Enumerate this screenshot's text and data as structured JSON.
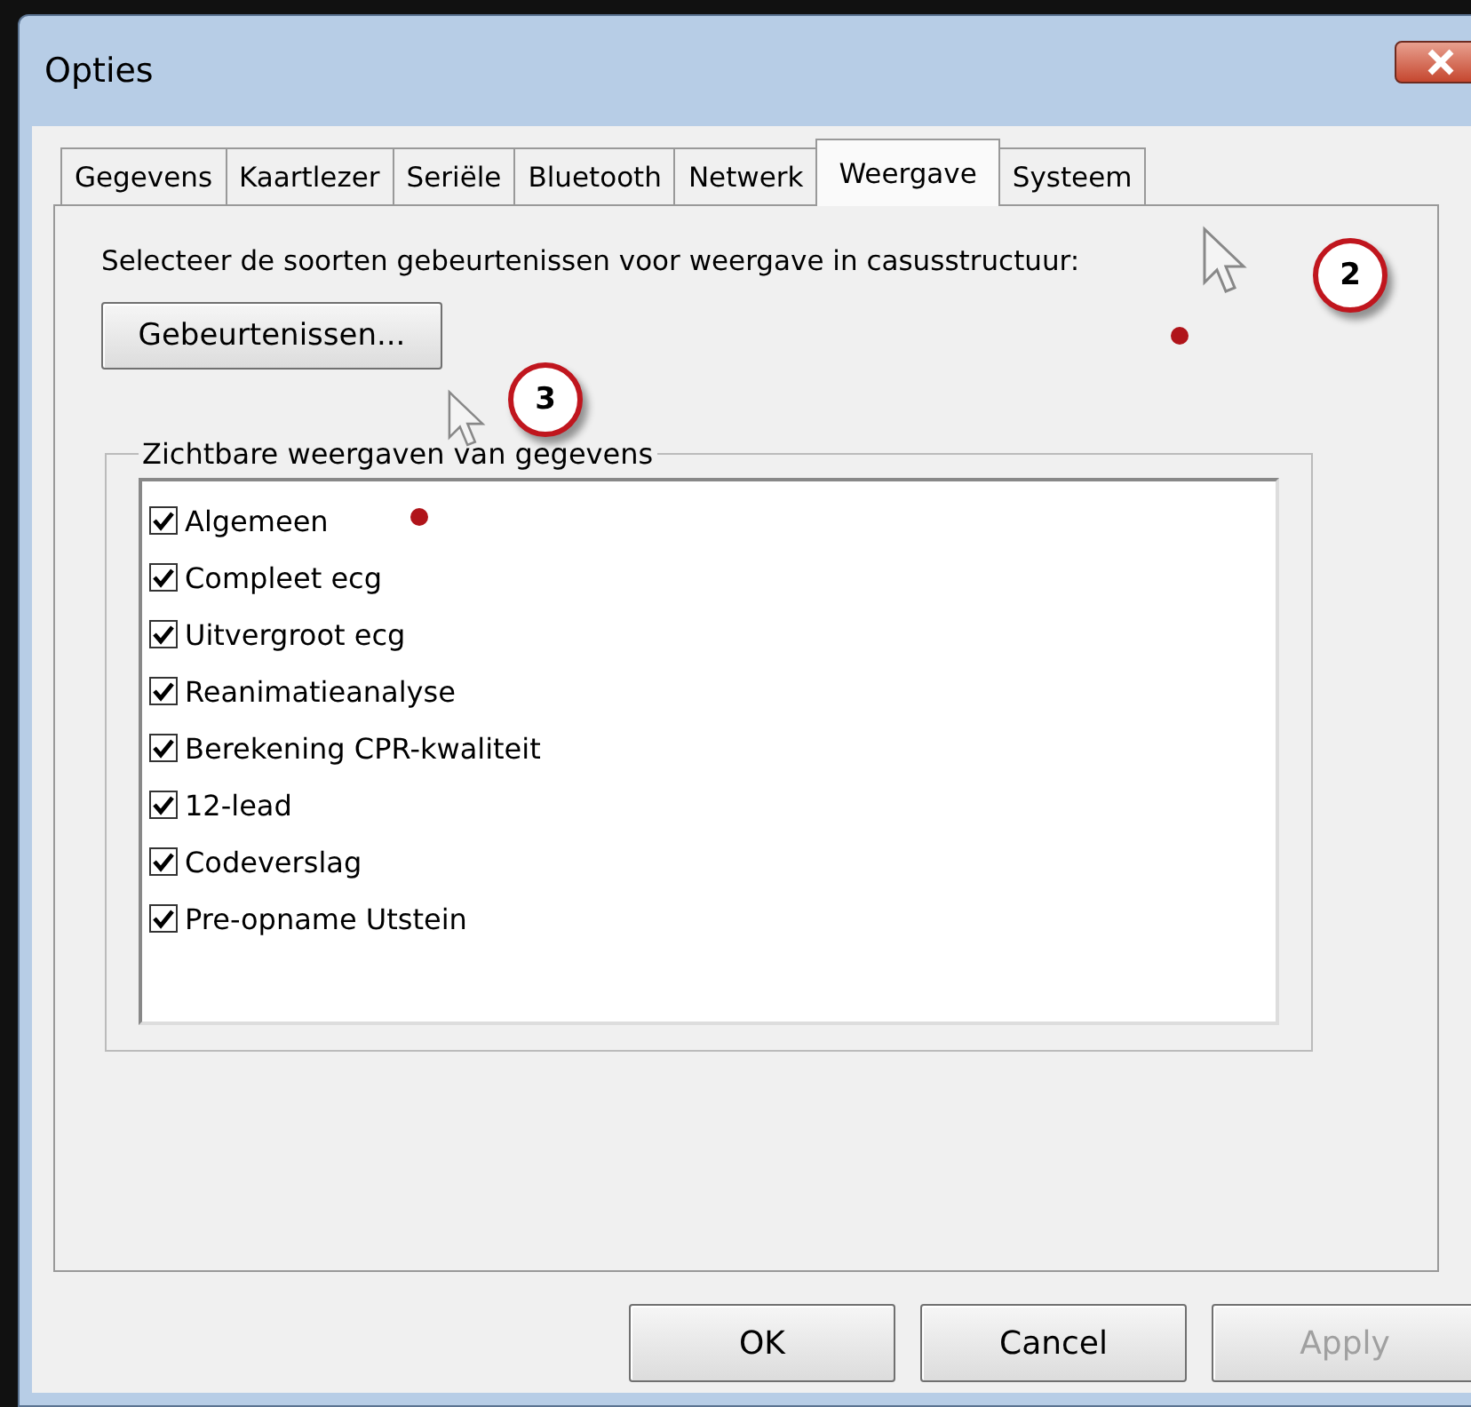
{
  "window": {
    "title": "Opties"
  },
  "tabs": [
    {
      "label": "Gegevens",
      "selected": false
    },
    {
      "label": "Kaartlezer",
      "selected": false
    },
    {
      "label": "Seriële",
      "selected": false
    },
    {
      "label": "Bluetooth",
      "selected": false
    },
    {
      "label": "Netwerk",
      "selected": false
    },
    {
      "label": "Weergave",
      "selected": true
    },
    {
      "label": "Systeem",
      "selected": false
    }
  ],
  "instruction": "Selecteer de soorten gebeurtenissen voor weergave in casusstructuur:",
  "events_button": {
    "label": "Gebeurtenissen..."
  },
  "group": {
    "legend": "Zichtbare weergaven van gegevens",
    "items": [
      {
        "label": "Algemeen",
        "checked": true
      },
      {
        "label": "Compleet ecg",
        "checked": true
      },
      {
        "label": "Uitvergroot ecg",
        "checked": true
      },
      {
        "label": "Reanimatieanalyse",
        "checked": true
      },
      {
        "label": "Berekening CPR-kwaliteit",
        "checked": true
      },
      {
        "label": "12-lead",
        "checked": true
      },
      {
        "label": "Codeverslag",
        "checked": true
      },
      {
        "label": "Pre-opname Utstein",
        "checked": true
      }
    ]
  },
  "buttons": [
    {
      "label": "OK",
      "disabled": false
    },
    {
      "label": "Cancel",
      "disabled": false
    },
    {
      "label": "Apply",
      "disabled": true
    }
  ],
  "callouts": [
    {
      "label": "2"
    },
    {
      "label": "3"
    }
  ]
}
